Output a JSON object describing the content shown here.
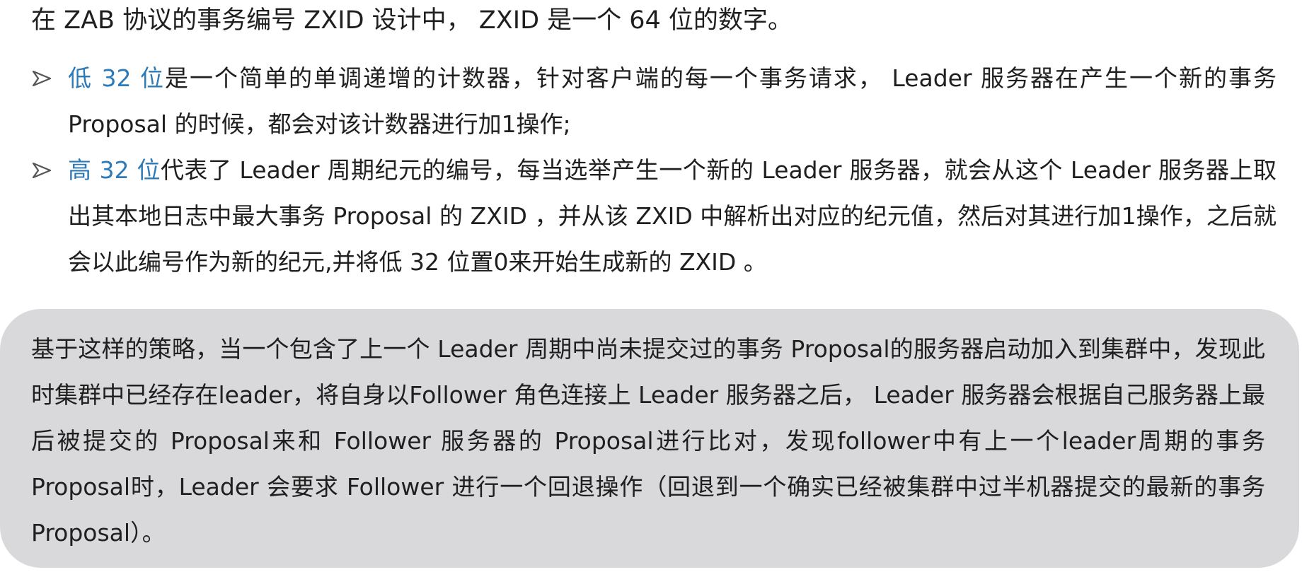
{
  "intro": "在 ZAB 协议的事务编号 ZXID 设计中， ZXID 是一个 64 位的数字。",
  "bullets": [
    {
      "highlight": "低 32 位",
      "text": "是一个简单的单调递增的计数器，针对客户端的每一个事务请求， Leader 服务器在产生一个新的事务 Proposal 的时候，都会对该计数器进行加1操作;"
    },
    {
      "highlight": "高 32 位",
      "text": "代表了 Leader 周期纪元的编号，每当选举产生一个新的 Leader 服务器，就会从这个 Leader 服务器上取出其本地日志中最大事务 Proposal 的 ZXID ，并从该 ZXID 中解析出对应的纪元值，然后对其进行加1操作，之后就会以此编号作为新的纪元,并将低 32 位置0来开始生成新的 ZXID 。"
    }
  ],
  "callout": {
    "text": "基于这样的策略，当一个包含了上一个 Leader 周期中尚未提交过的事务 Proposal的服务器启动加入到集群中，发现此时集群中已经存在leader，将自身以Follower 角色连接上 Leader 服务器之后， Leader 服务器会根据自己服务器上最后被提交的 Proposal来和 Follower 服务器的 Proposal进行比对，发现follower中有上一个leader周期的事务Proposal时，Leader 会要求 Follower 进行一个回退操作（回退到一个确实已经被集群中过半机器提交的最新的事务 Proposal）。"
  },
  "colors": {
    "highlight": "#2e7ab7",
    "callout_background": "#d9d9db",
    "text": "#1f1f1f"
  },
  "icons": {
    "bullet": "arrowhead-icon"
  }
}
